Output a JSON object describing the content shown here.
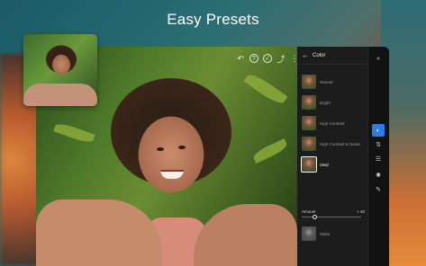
{
  "headline": "Easy Presets",
  "toolbar": {
    "icons": [
      "undo-icon",
      "help-icon",
      "check-icon",
      "share-icon",
      "more-icon"
    ]
  },
  "panel": {
    "title": "Color",
    "presets": [
      {
        "label": "Natural",
        "selected": false
      },
      {
        "label": "Bright",
        "selected": false
      },
      {
        "label": "High Contrast",
        "selected": false
      },
      {
        "label": "High Contrast & Detail",
        "selected": false
      },
      {
        "label": "Vivid",
        "selected": true
      },
      {
        "label": "Matte",
        "selected": false
      }
    ],
    "amount": {
      "label": "Amount",
      "value": "+ 40"
    }
  },
  "rail": {
    "icons": [
      "presets-icon",
      "tone-icon",
      "adjust-icon",
      "color-icon",
      "brush-icon"
    ]
  }
}
